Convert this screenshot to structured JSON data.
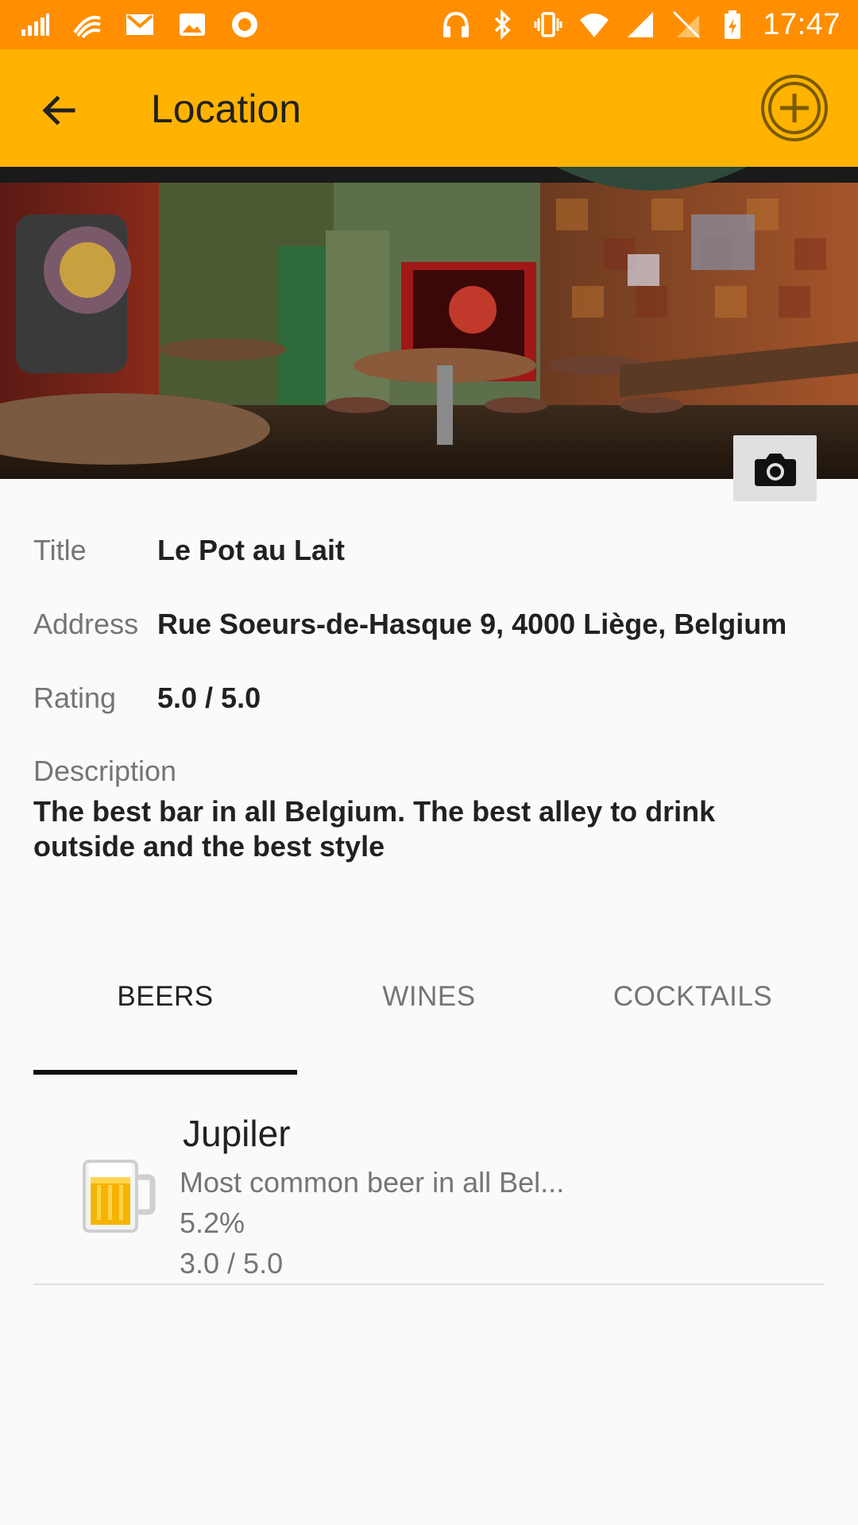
{
  "status_bar": {
    "time": "17:47",
    "left_icons": [
      "signal-bars-icon",
      "wifi-calling-icon",
      "gmail-icon",
      "gallery-icon",
      "record-icon"
    ],
    "right_icons": [
      "headphones-icon",
      "bluetooth-icon",
      "vibrate-icon",
      "wifi-icon",
      "cell-signal-icon",
      "no-sim-icon",
      "battery-icon"
    ]
  },
  "toolbar": {
    "title": "Location",
    "back_icon": "arrow-back-icon",
    "add_icon": "add-circle-icon"
  },
  "hero": {
    "image": "bar-interior-photo",
    "camera_icon": "camera-icon"
  },
  "details": {
    "title_label": "Title",
    "title_value": "Le Pot au Lait",
    "address_label": "Address",
    "address_value": "Rue Soeurs-de-Hasque 9, 4000 Liège, Belgium",
    "rating_label": "Rating",
    "rating_value": "5.0 / 5.0",
    "description_label": "Description",
    "description_value": "The best bar in all Belgium. The best alley to drink outside and the best style"
  },
  "tabs": [
    {
      "label": "BEERS",
      "active": true
    },
    {
      "label": "WINES",
      "active": false
    },
    {
      "label": "COCKTAILS",
      "active": false
    }
  ],
  "items": [
    {
      "icon": "beer-mug-icon",
      "name": "Jupiler",
      "description": "Most common beer in all Bel...",
      "abv": "5.2%",
      "rating": "3.0 / 5.0"
    }
  ],
  "colors": {
    "status_bar": "#ff8f00",
    "toolbar": "#ffb300",
    "background": "#fafafa"
  }
}
